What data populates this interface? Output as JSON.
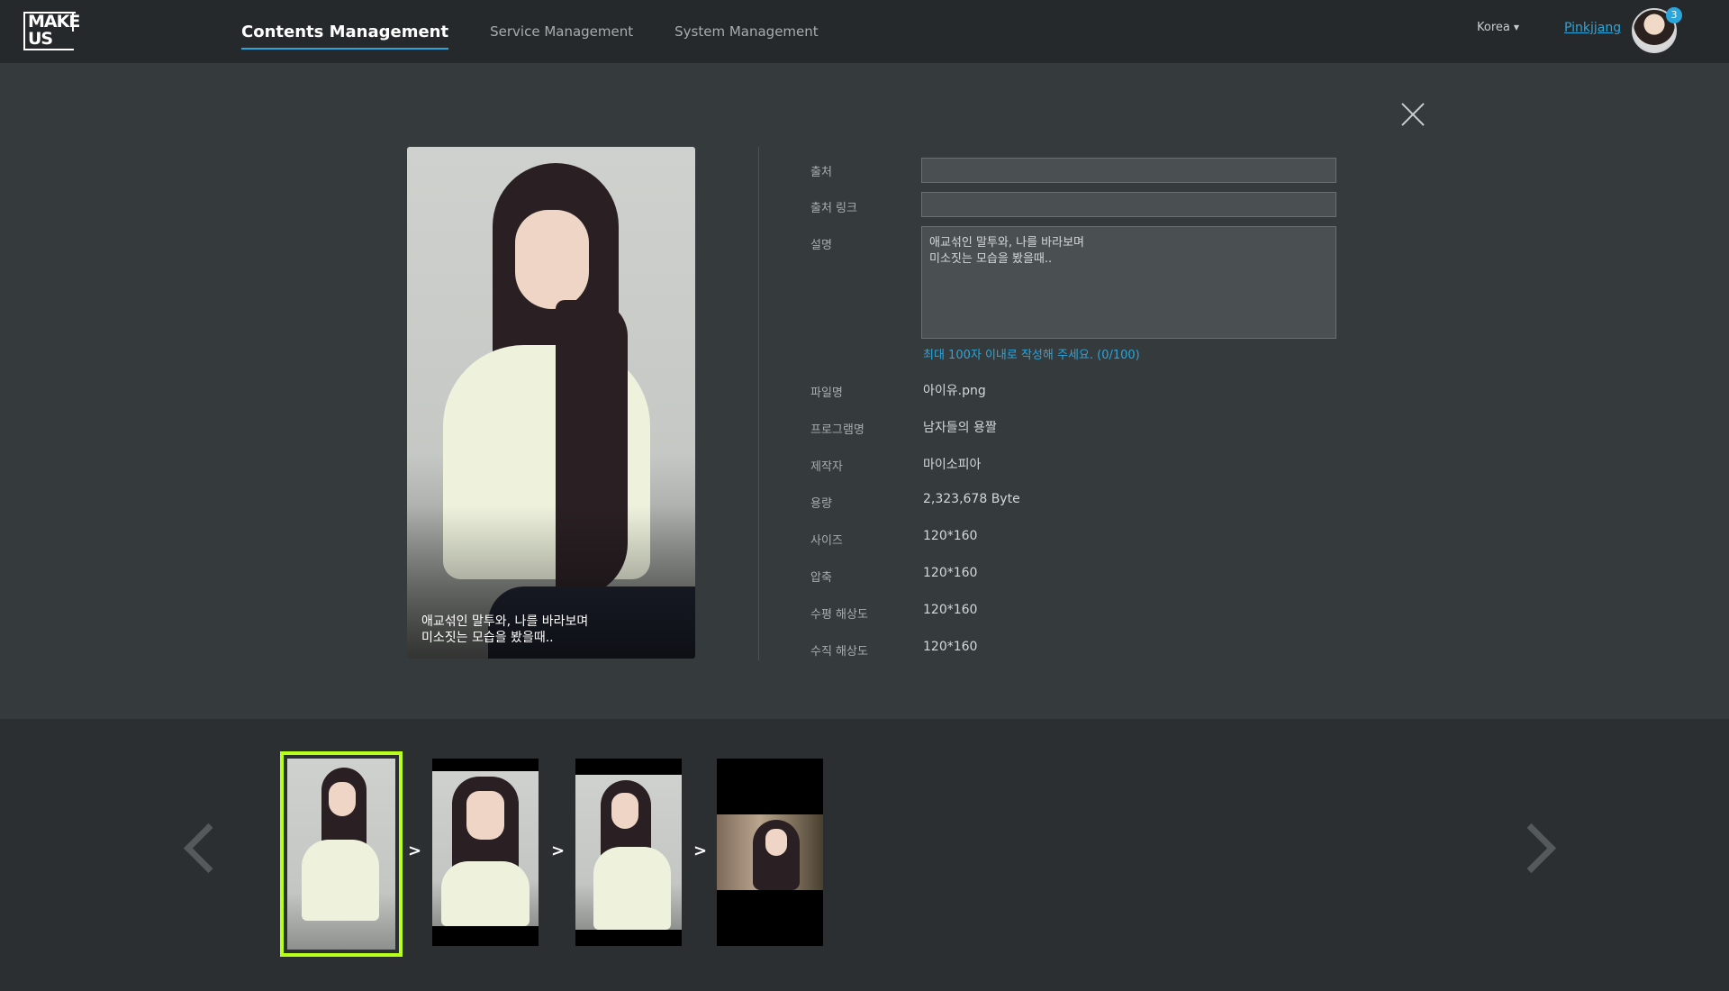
{
  "app": {
    "logo_line1": "MAKE",
    "logo_line2": "US"
  },
  "nav": {
    "items": [
      {
        "label": "Contents Management",
        "active": true
      },
      {
        "label": "Service Management",
        "active": false
      },
      {
        "label": "System Management",
        "active": false
      }
    ]
  },
  "header": {
    "region": "Korea",
    "username": "Pinkjjang",
    "notification_count": "3"
  },
  "preview": {
    "caption": "애교섞인 말투와, 나를 바라보며\n미소짓는 모습을 봤을때.."
  },
  "form": {
    "source_label": "출처",
    "source_value": "",
    "source_link_label": "출처 링크",
    "source_link_value": "",
    "description_label": "설명",
    "description_value": "애교섞인 말투와, 나를 바라보며\n미소짓는 모습을 봤을때..",
    "description_hint": "최대 100자 이내로 작성해 주세요. (0/100)"
  },
  "details": [
    {
      "label": "파일명",
      "value": "아이유.png"
    },
    {
      "label": "프로그램명",
      "value": "남자들의 용짤"
    },
    {
      "label": "제작자",
      "value": "마이소피아"
    },
    {
      "label": "용량",
      "value": "2,323,678 Byte"
    },
    {
      "label": "사이즈",
      "value": "120*160"
    },
    {
      "label": "압축",
      "value": "120*160"
    },
    {
      "label": "수평 해상도",
      "value": "120*160"
    },
    {
      "label": "수직 해상도",
      "value": "120*160"
    }
  ],
  "thumbnails": {
    "separator": ">",
    "count": 4,
    "selected_index": 0
  },
  "colors": {
    "accent": "#2aa6dc",
    "selection": "#b9ff1c",
    "background": "#353a3c",
    "topbar": "#26292b"
  },
  "icons": {
    "close": "close-icon",
    "prev": "chevron-left-icon",
    "next": "chevron-right-icon"
  }
}
